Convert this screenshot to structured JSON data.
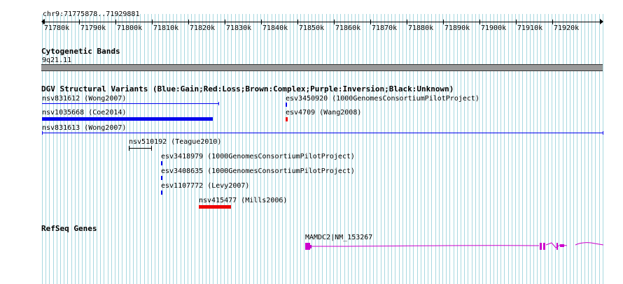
{
  "coordinates": "chr9:71775878..71929881",
  "ruler_ticks": [
    "71780k",
    "71790k",
    "71800k",
    "71810k",
    "71820k",
    "71830k",
    "71840k",
    "71850k",
    "71860k",
    "71870k",
    "71880k",
    "71890k",
    "71900k",
    "71910k",
    "71920k"
  ],
  "tracks": {
    "cytoband": {
      "title": "Cytogenetic Bands",
      "band": "9q21.11"
    },
    "dgv": {
      "title": "DGV Structural Variants (Blue:Gain;Red:Loss;Brown:Complex;Purple:Inversion;Black:Unknown)",
      "features": [
        {
          "label": "nsv831612 (Wong2007)"
        },
        {
          "label": "nsv1035668 (Coe2014)"
        },
        {
          "label": "nsv831613 (Wong2007)"
        },
        {
          "label": "nsv510192 (Teague2010)"
        },
        {
          "label": "esv3418979 (1000GenomesConsortiumPilotProject)"
        },
        {
          "label": "esv3408635 (1000GenomesConsortiumPilotProject)"
        },
        {
          "label": "esv1107772 (Levy2007)"
        },
        {
          "label": "nsv415477 (Mills2006)"
        },
        {
          "label": "esv3450920 (1000GenomesConsortiumPilotProject)"
        },
        {
          "label": "esv4709 (Wang2008)"
        }
      ]
    },
    "refseq": {
      "title": "RefSeq Genes",
      "gene": "MAMDC2|NM_153267"
    }
  },
  "colors": {
    "gain": "#0000ee",
    "loss": "#ee0000",
    "gene": "#cc00cc",
    "grid": "#a8d8e0",
    "band_bg": "#999999"
  }
}
